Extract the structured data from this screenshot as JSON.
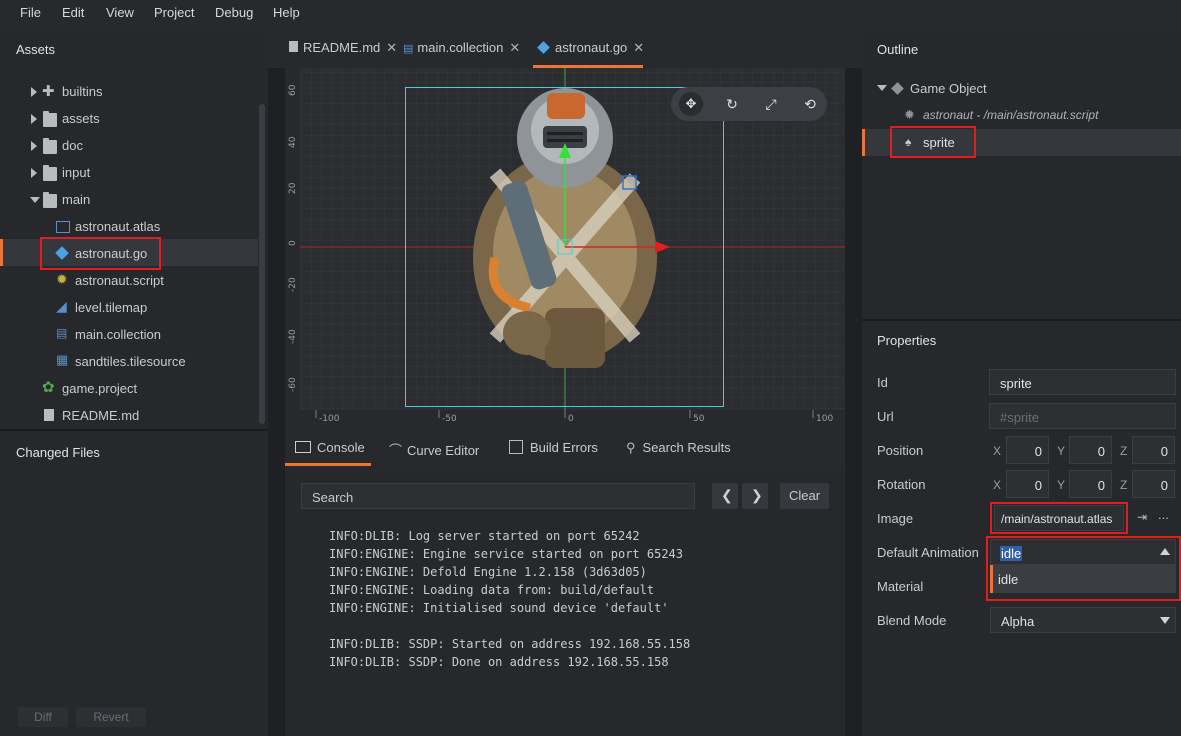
{
  "menu": [
    "File",
    "Edit",
    "View",
    "Project",
    "Debug",
    "Help"
  ],
  "assets": {
    "title": "Assets",
    "items": [
      {
        "label": "builtins"
      },
      {
        "label": "assets"
      },
      {
        "label": "doc"
      },
      {
        "label": "input"
      },
      {
        "label": "main"
      },
      {
        "label": "astronaut.atlas"
      },
      {
        "label": "astronaut.go"
      },
      {
        "label": "astronaut.script"
      },
      {
        "label": "level.tilemap"
      },
      {
        "label": "main.collection"
      },
      {
        "label": "sandtiles.tilesource"
      },
      {
        "label": "game.project"
      },
      {
        "label": "README.md"
      }
    ]
  },
  "changed_files": {
    "title": "Changed Files",
    "diff_label": "Diff",
    "revert_label": "Revert"
  },
  "editor_tabs": [
    {
      "label": "README.md"
    },
    {
      "label": "main.collection"
    },
    {
      "label": "astronaut.go"
    }
  ],
  "tab_close": "✕",
  "scene": {
    "y_ticks": [
      "60",
      "40",
      "20",
      "0",
      "-20",
      "-40",
      "-60"
    ],
    "x_ticks": [
      "-100",
      "-50",
      "0",
      "50",
      "100"
    ]
  },
  "bottom_tabs": [
    {
      "label": "Console"
    },
    {
      "label": "Curve Editor"
    },
    {
      "label": "Build Errors"
    },
    {
      "label": "Search Results"
    }
  ],
  "console": {
    "search_placeholder": "Search",
    "clear_label": "Clear",
    "lines": [
      "INFO:DLIB: Log server started on port 65242",
      "INFO:ENGINE: Engine service started on port 65243",
      "INFO:ENGINE: Defold Engine 1.2.158 (3d63d05)",
      "INFO:ENGINE: Loading data from: build/default",
      "INFO:ENGINE: Initialised sound device 'default'",
      "",
      "INFO:DLIB: SSDP: Started on address 192.168.55.158",
      "INFO:DLIB: SSDP: Done on address 192.168.55.158"
    ]
  },
  "outline": {
    "title": "Outline",
    "root": "Game Object",
    "script": "astronaut - /main/astronaut.script",
    "sprite": "sprite"
  },
  "properties": {
    "title": "Properties",
    "id_label": "Id",
    "id_value": "sprite",
    "url_label": "Url",
    "url_placeholder": "#sprite",
    "position_label": "Position",
    "rotation_label": "Rotation",
    "axis_x": "X",
    "axis_y": "Y",
    "axis_z": "Z",
    "position": [
      "0",
      "0",
      "0"
    ],
    "rotation": [
      "0",
      "0",
      "0"
    ],
    "image_label": "Image",
    "image_value": "/main/astronaut.atlas",
    "more_label": "...",
    "default_animation_label": "Default Animation",
    "default_animation_value": "idle",
    "dropdown_option": "idle",
    "material_label": "Material",
    "blend_mode_label": "Blend Mode",
    "blend_mode_value": "Alpha"
  },
  "colors": {
    "accent": "#e8753a",
    "highlight": "#e01e1e",
    "selection_box": "#38d6d6"
  }
}
